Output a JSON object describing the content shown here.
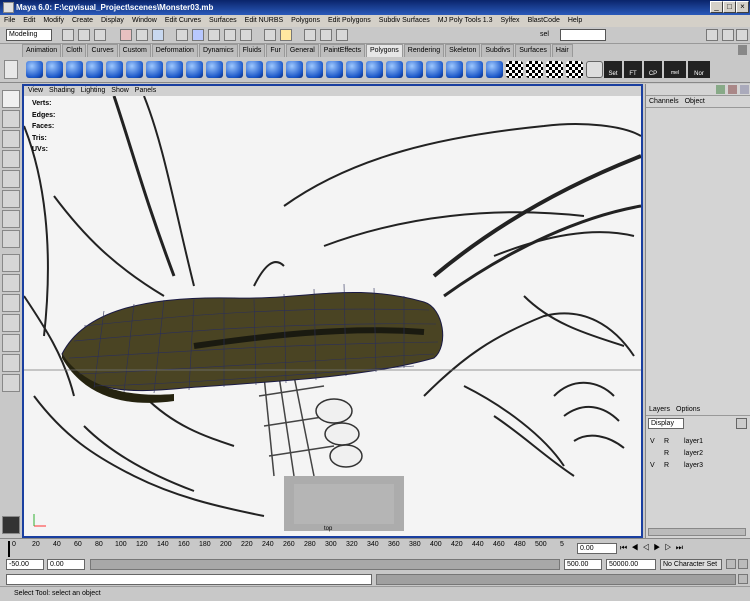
{
  "window": {
    "title": "Maya 6.0: F:\\cgvisual_Project\\scenes\\Monster03.mb",
    "min": "_",
    "max": "□",
    "close": "×"
  },
  "menu": [
    "File",
    "Edit",
    "Modify",
    "Create",
    "Display",
    "Window",
    "Edit Curves",
    "Surfaces",
    "Edit NURBS",
    "Polygons",
    "Edit Polygons",
    "Subdiv Surfaces",
    "MJ Poly Tools 1.3",
    "Sylfex",
    "BlastCode",
    "Help"
  ],
  "status_line": {
    "mode": "Modeling",
    "sel_label": "sel"
  },
  "shelf_tabs": [
    "Animation",
    "Cloth",
    "Curves",
    "Custom",
    "Deformation",
    "Dynamics",
    "Fluids",
    "Fur",
    "General",
    "PaintEffects",
    "Polygons",
    "Rendering",
    "Skeleton",
    "Subdivs",
    "Surfaces",
    "Hair"
  ],
  "active_shelf": "Polygons",
  "shelf_text_buttons": [
    "Set",
    "FT",
    "CP",
    "mel button",
    "Nor"
  ],
  "panel_menu": [
    "View",
    "Shading",
    "Lighting",
    "Show",
    "Panels"
  ],
  "hud": [
    "Verts:",
    "Edges:",
    "Faces:",
    "Tris:",
    "UVs:"
  ],
  "camera_label": "top",
  "channel_box": {
    "tabs": [
      "Channels",
      "Object"
    ]
  },
  "layers": {
    "tabs": [
      "Layers",
      "Options"
    ],
    "display": "Display",
    "rows": [
      {
        "v": "V",
        "r": "R",
        "name": "layer1"
      },
      {
        "v": "",
        "r": "R",
        "name": "layer2"
      },
      {
        "v": "V",
        "r": "R",
        "name": "layer3"
      }
    ]
  },
  "timeline": {
    "ticks": [
      "0",
      "20",
      "40",
      "60",
      "80",
      "100",
      "120",
      "140",
      "160",
      "180",
      "200",
      "220",
      "240",
      "260",
      "280",
      "300",
      "320",
      "340",
      "360",
      "380",
      "400",
      "420",
      "440",
      "460",
      "480",
      "500",
      "5"
    ],
    "current": "0.00"
  },
  "range": {
    "start": "-50.00",
    "start2": "0.00",
    "end": "500.00",
    "end2": "50000.00",
    "character": "No Character Set"
  },
  "help_line": "Select Tool: select an object"
}
